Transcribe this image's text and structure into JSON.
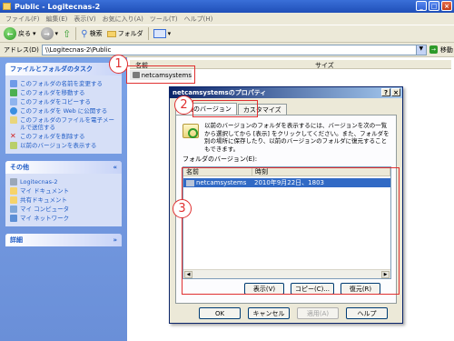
{
  "window": {
    "title": "Public - Logitecnas-2",
    "minimize": "_",
    "maximize": "□",
    "close": "×"
  },
  "menu": [
    "ファイル(F)",
    "編集(E)",
    "表示(V)",
    "お気に入り(A)",
    "ツール(T)",
    "ヘルプ(H)"
  ],
  "toolbar": {
    "back": "戻る",
    "search": "検索",
    "folders": "フォルダ"
  },
  "address": {
    "label": "アドレス(D)",
    "value": "\\\\Logitecnas-2\\Public",
    "go": "移動"
  },
  "tasks": {
    "folder_tasks_title": "ファイルとフォルダのタスク",
    "folder_tasks": [
      "このフォルダの名前を変更する",
      "このフォルダを移動する",
      "このフォルダをコピーする",
      "このフォルダを Web に公開する",
      "このフォルダのファイルを電子メールで送信する",
      "このフォルダを削除する",
      "以前のバージョンを表示する"
    ],
    "other_title": "その他",
    "other": [
      "Logitecnas-2",
      "マイ ドキュメント",
      "共有ドキュメント",
      "マイ コンピュータ",
      "マイ ネットワーク"
    ],
    "details_title": "詳細"
  },
  "filelist": {
    "col_name": "名前",
    "col_size": "サイズ",
    "item": "netcamsystems"
  },
  "dialog": {
    "title": "netcamsystemsのプロパティ",
    "help": "?",
    "close": "×",
    "tabs": [
      "以前のバージョン",
      "カスタマイズ"
    ],
    "description": "以前のバージョンのフォルダを表示するには、バージョンを次の一覧から選択してから [表示] をクリックしてください。また、フォルダを別の場所に保存したり、以前のバージョンのフォルダに復元することもできます。",
    "versions_label": "フォルダのバージョン(E):",
    "col_name": "名前",
    "col_time": "時刻",
    "version_name": "netcamsystems",
    "version_time": "2010年9月22日、1803",
    "btn_view": "表示(V)",
    "btn_copy": "コピー(C)...",
    "btn_restore": "復元(R)",
    "btn_ok": "OK",
    "btn_cancel": "キャンセル",
    "btn_apply": "適用(A)",
    "btn_help": "ヘルプ"
  },
  "annotations": [
    "1",
    "2",
    "3"
  ],
  "colors": {
    "annotation_red": "#e03030",
    "selection_blue": "#316ac5",
    "xp_title_blue": "#1f4fb8"
  }
}
